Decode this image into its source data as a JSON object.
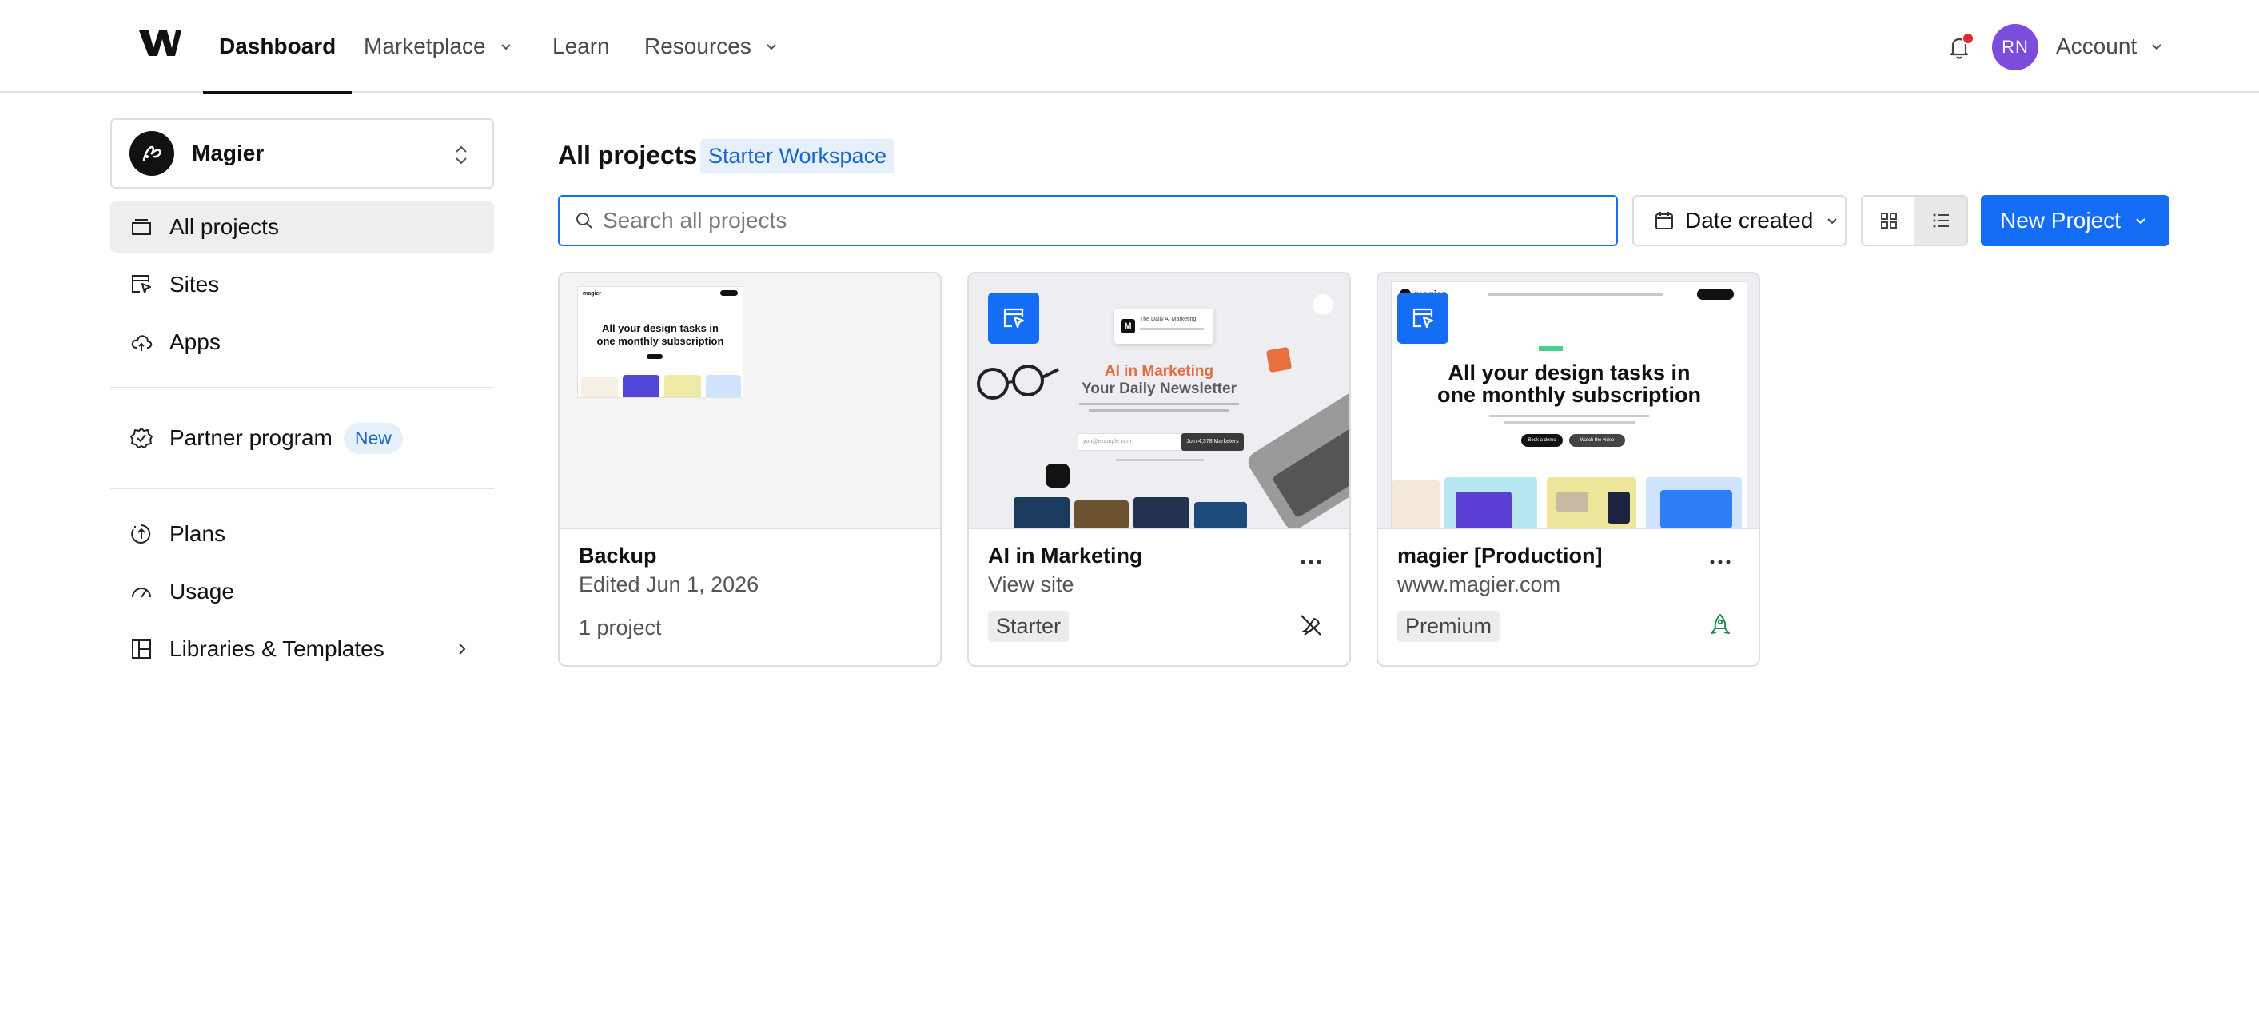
{
  "nav": {
    "items": [
      {
        "label": "Dashboard",
        "active": true,
        "dropdown": false
      },
      {
        "label": "Marketplace",
        "active": false,
        "dropdown": true
      },
      {
        "label": "Learn",
        "active": false,
        "dropdown": false
      },
      {
        "label": "Resources",
        "active": false,
        "dropdown": true
      }
    ],
    "avatar_initials": "RN",
    "account_label": "Account",
    "has_notification": true
  },
  "sidebar": {
    "workspace_name": "Magier",
    "items": [
      {
        "label": "All projects",
        "icon": "folder-icon",
        "active": true
      },
      {
        "label": "Sites",
        "icon": "sites-cursor-icon"
      },
      {
        "label": "Apps",
        "icon": "cloud-app-icon"
      },
      {
        "label": "Partner program",
        "icon": "partner-badge-icon",
        "badge": "New"
      },
      {
        "label": "Plans",
        "icon": "plans-icon"
      },
      {
        "label": "Usage",
        "icon": "gauge-icon"
      },
      {
        "label": "Libraries & Templates",
        "icon": "library-icon",
        "arrow": true
      }
    ]
  },
  "main": {
    "title": "All projects",
    "workspace_badge": "Starter Workspace",
    "search_placeholder": "Search all projects",
    "sort_label": "Date created",
    "view_mode": "list",
    "new_project_label": "New Project"
  },
  "cards": [
    {
      "title": "Backup",
      "subtitle": "Edited Jun 1, 2026",
      "meta": "1 project",
      "type": "folder"
    },
    {
      "title": "AI in Marketing",
      "subtitle": "View site",
      "plan": "Starter",
      "published": false,
      "thumb": {
        "brand": "The Daily AI Marketing",
        "headline_1": "AI in Marketing",
        "headline_2": "Your Daily Newsletter",
        "cta": "Join 4,378 Marketers",
        "email_placeholder": "you@example.com"
      }
    },
    {
      "title": "magier [Production]",
      "subtitle": "www.magier.com",
      "plan": "Premium",
      "published": true,
      "thumb": {
        "brand": "magier",
        "headline_1": "All your design tasks in",
        "headline_2": "one monthly subscription",
        "cta_1": "Book a demo",
        "cta_2": "Watch the video"
      }
    }
  ],
  "backup_thumb": {
    "brand": "magier",
    "headline_1": "All your design tasks in",
    "headline_2": "one monthly subscription"
  },
  "colors": {
    "accent": "#146ef5",
    "badge_text": "#1c66c9",
    "badge_bg": "#e6f0fb",
    "avatar": "#7c4ddb",
    "notification": "#e5282b",
    "published": "#1f8a4c"
  }
}
